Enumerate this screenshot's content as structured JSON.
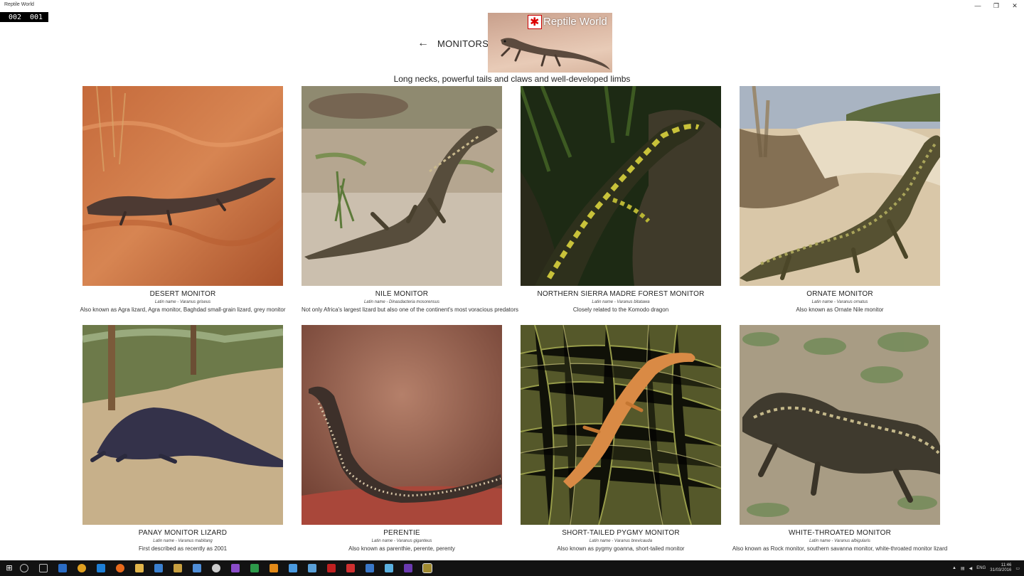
{
  "window": {
    "title": "Reptile World",
    "minimize": "—",
    "maximize": "❐",
    "close": "✕"
  },
  "counter": {
    "left": "002",
    "right": "001"
  },
  "header": {
    "back_icon": "arrow-left-icon",
    "back_glyph": "←",
    "heading": "MONITORS",
    "logo_text": "Reptile World",
    "subtitle": "Long necks, powerful tails and claws and well-developed limbs"
  },
  "cards": [
    {
      "name": "DESERT MONITOR",
      "latin": "Latin name - Varanus griseus",
      "desc": "Also known as Agra lizard, Agra monitor, Baghdad small-grain lizard, grey monitor"
    },
    {
      "name": "NILE MONITOR",
      "latin": "Latin name - Dinasdacteria mosorensus",
      "desc": "Not only Africa's largest lizard but also one of the continent's most voracious predators"
    },
    {
      "name": "NORTHERN SIERRA MADRE FOREST MONITOR",
      "latin": "Latin name - Varanus bitatawa",
      "desc": "Closely related to the Komodo dragon"
    },
    {
      "name": "ORNATE MONITOR",
      "latin": "Latin name - Varanus ornatus",
      "desc": "Also known as Ornate Nile monitor"
    },
    {
      "name": "PANAY MONITOR LIZARD",
      "latin": "Latin name - Varanus mabitang",
      "desc": "First described as recently as 2001"
    },
    {
      "name": "PERENTIE",
      "latin": "Latin name - Varanus giganteus",
      "desc": "Also known as parenthie, perente, perenty"
    },
    {
      "name": "SHORT-TAILED PYGMY MONITOR",
      "latin": "Latin name - Varanus brevicauda",
      "desc": "Also known as pygmy goanna, short-tailed monitor"
    },
    {
      "name": "WHITE-THROATED MONITOR",
      "latin": "Latin name - Varanus albigularis",
      "desc": "Also known as Rock monitor, southern savanna monitor, white-throated monitor lizard"
    }
  ],
  "taskbar": {
    "start_glyph": "⊞",
    "tray_lang": "ENG",
    "time": "11:46",
    "date": "31/03/2016"
  },
  "colors": {
    "taskbar": "#121212",
    "counter_bg": "#000000"
  }
}
